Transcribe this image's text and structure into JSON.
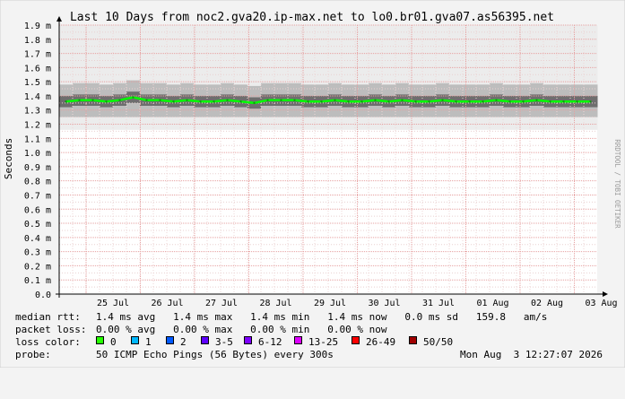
{
  "chart_data": {
    "type": "line",
    "title": "Last 10 Days from noc2.gva20.ip-max.net to lo0.br01.gva07.as56395.net",
    "ylabel": "Seconds",
    "xlabel": "",
    "watermark": "RRDTOOL / TOBI OETIKER",
    "ylim": [
      0,
      0.0019
    ],
    "y_ticks": [
      "0.0",
      "0.1 m",
      "0.2 m",
      "0.3 m",
      "0.4 m",
      "0.5 m",
      "0.6 m",
      "0.7 m",
      "0.8 m",
      "0.9 m",
      "1.0 m",
      "1.1 m",
      "1.2 m",
      "1.3 m",
      "1.4 m",
      "1.5 m",
      "1.6 m",
      "1.7 m",
      "1.8 m",
      "1.9 m"
    ],
    "x_ticks": [
      "25 Jul",
      "26 Jul",
      "27 Jul",
      "28 Jul",
      "29 Jul",
      "30 Jul",
      "31 Jul",
      "01 Aug",
      "02 Aug",
      "03 Aug"
    ],
    "grid": true,
    "series": [
      {
        "name": "median rtt",
        "color": "#00ff00",
        "values": [
          0.00136,
          0.00137,
          0.00137,
          0.00136,
          0.00137,
          0.00139,
          0.00137,
          0.00137,
          0.00136,
          0.00137,
          0.00136,
          0.00136,
          0.00137,
          0.00136,
          0.00135,
          0.00137,
          0.00137,
          0.00137,
          0.00136,
          0.00136,
          0.00137,
          0.00136,
          0.00136,
          0.00137,
          0.00136,
          0.00137,
          0.00136,
          0.00136,
          0.00137,
          0.00136,
          0.00136,
          0.00136,
          0.00137,
          0.00136,
          0.00136,
          0.00137,
          0.00136,
          0.00136,
          0.00136,
          0.00136
        ]
      }
    ]
  },
  "stats": {
    "median_rtt_label": "median rtt:",
    "median_rtt_values": "1.4 ms avg   1.4 ms max   1.4 ms min   1.4 ms now   0.0 ms sd   159.8   am/s",
    "packet_loss_label": "packet loss:",
    "packet_loss_values": "0.00 % avg   0.00 % max   0.00 % min   0.00 % now",
    "loss_color_label": "loss color:",
    "loss_colors": [
      {
        "label": "0",
        "color": "#26ff00"
      },
      {
        "label": "1",
        "color": "#00b8ff"
      },
      {
        "label": "2",
        "color": "#0059ff"
      },
      {
        "label": "3-5",
        "color": "#5e00ff"
      },
      {
        "label": "6-12",
        "color": "#7e00ff"
      },
      {
        "label": "13-25",
        "color": "#dd00ff"
      },
      {
        "label": "26-49",
        "color": "#ff0000"
      },
      {
        "label": "50/50",
        "color": "#a00000"
      }
    ],
    "probe_label": "probe:",
    "probe_value": "50 ICMP Echo Pings (56 Bytes) every 300s",
    "timestamp": "Mon Aug  3 12:27:07 2026"
  }
}
